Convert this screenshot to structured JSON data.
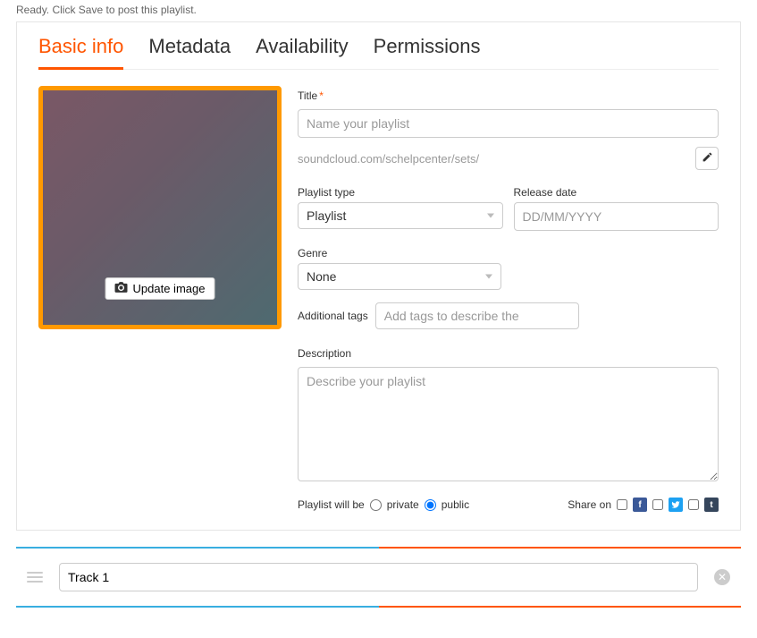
{
  "status": "Ready. Click Save to post this playlist.",
  "tabs": [
    {
      "label": "Basic info",
      "active": true
    },
    {
      "label": "Metadata",
      "active": false
    },
    {
      "label": "Availability",
      "active": false
    },
    {
      "label": "Permissions",
      "active": false
    }
  ],
  "image": {
    "update_label": "Update image"
  },
  "form": {
    "title_label": "Title",
    "title_required": "*",
    "title_placeholder": "Name your playlist",
    "url": "soundcloud.com/schelpcenter/sets/",
    "playlist_type_label": "Playlist type",
    "playlist_type_value": "Playlist",
    "release_date_label": "Release date",
    "release_date_placeholder": "DD/MM/YYYY",
    "genre_label": "Genre",
    "genre_value": "None",
    "tags_label": "Additional tags",
    "tags_placeholder": "Add tags to describe the",
    "description_label": "Description",
    "description_placeholder": "Describe your playlist",
    "privacy_label": "Playlist will be",
    "privacy_private": "private",
    "privacy_public": "public",
    "privacy_value": "public",
    "share_label": "Share on"
  },
  "tracks": [
    {
      "name": "Track 1"
    }
  ],
  "social": {
    "facebook": "f",
    "twitter": "t",
    "tumblr": "t"
  }
}
